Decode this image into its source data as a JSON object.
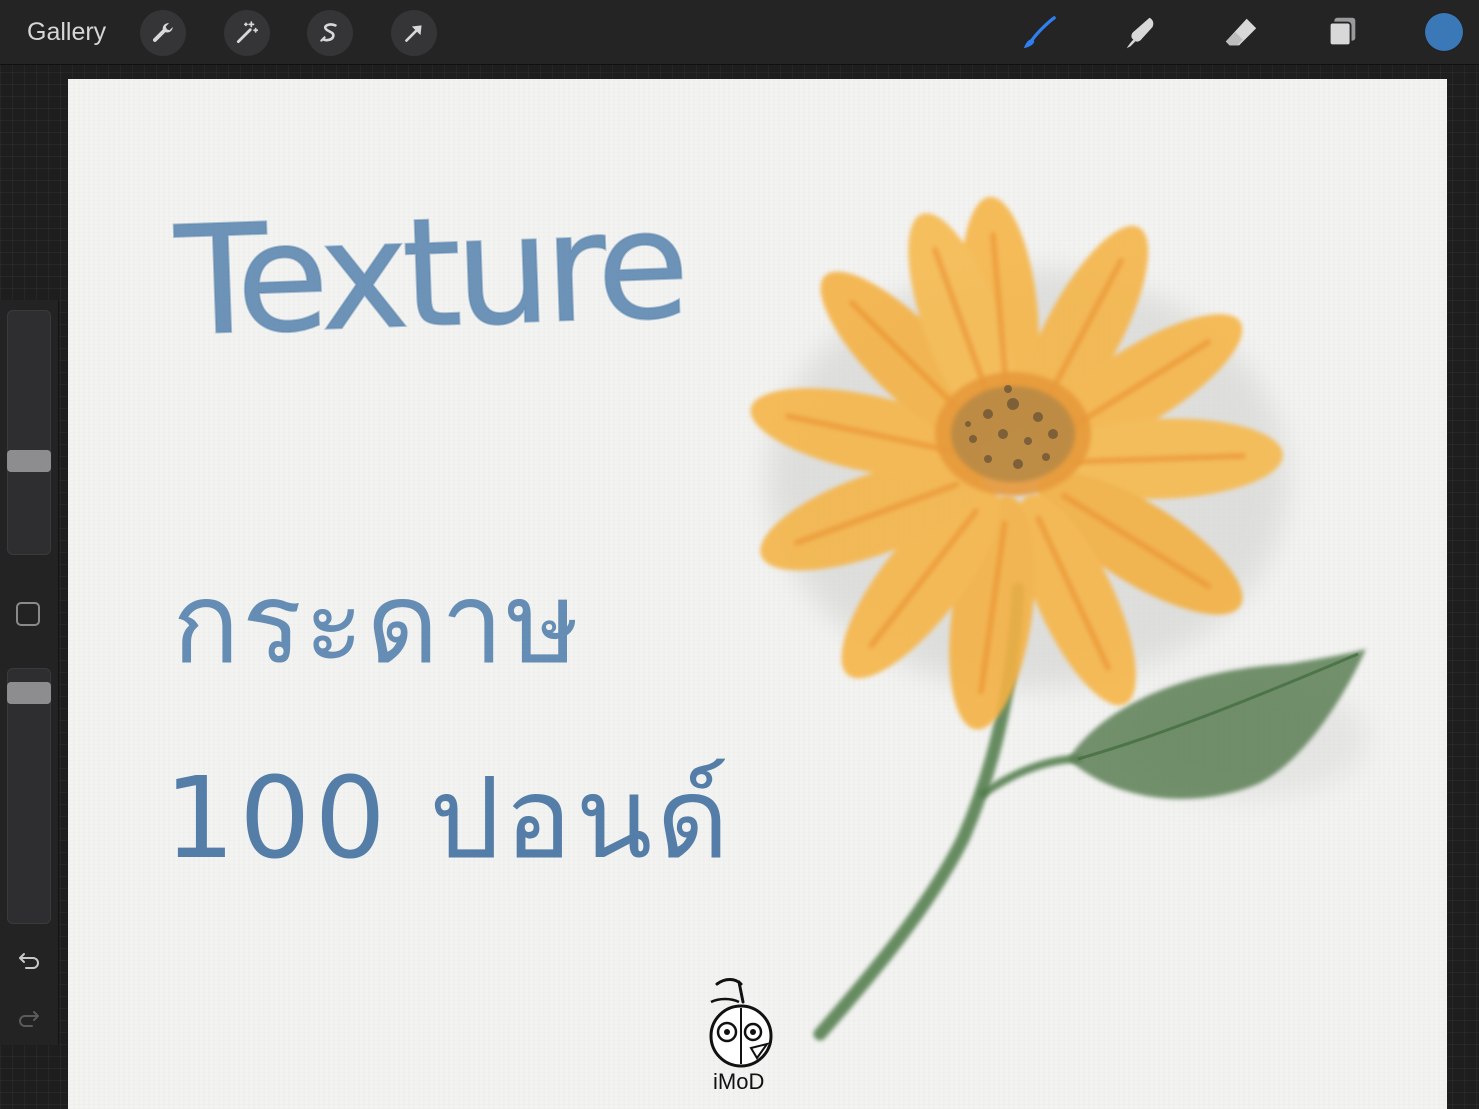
{
  "toolbar": {
    "gallery_label": "Gallery",
    "left_tools": [
      "wrench-icon",
      "magic-wand-icon",
      "selection-icon",
      "transform-arrow-icon"
    ],
    "right_tools": [
      "brush-icon",
      "smudge-icon",
      "eraser-icon",
      "layers-icon"
    ],
    "active_tool": "brush-icon",
    "active_color": "#3a78b8",
    "brush_accent": "#2f7ff0"
  },
  "sidebar": {
    "brush_size_level": 0.37,
    "opacity_level": 0.06,
    "buttons": [
      "modify-button",
      "undo-icon",
      "redo-icon"
    ]
  },
  "canvas": {
    "handwriting": {
      "line1": "Texture",
      "line2": "กระดาษ",
      "line3": "100 ปอนด์"
    },
    "watermark": {
      "text": "iMoD"
    },
    "colors": {
      "ink": "#4a7aa8",
      "petal": "#f6b64a",
      "petal_deep": "#ee8f22",
      "center": "#a07a3a",
      "stem": "#4f7a4a",
      "leaf": "#5b7f55"
    }
  }
}
